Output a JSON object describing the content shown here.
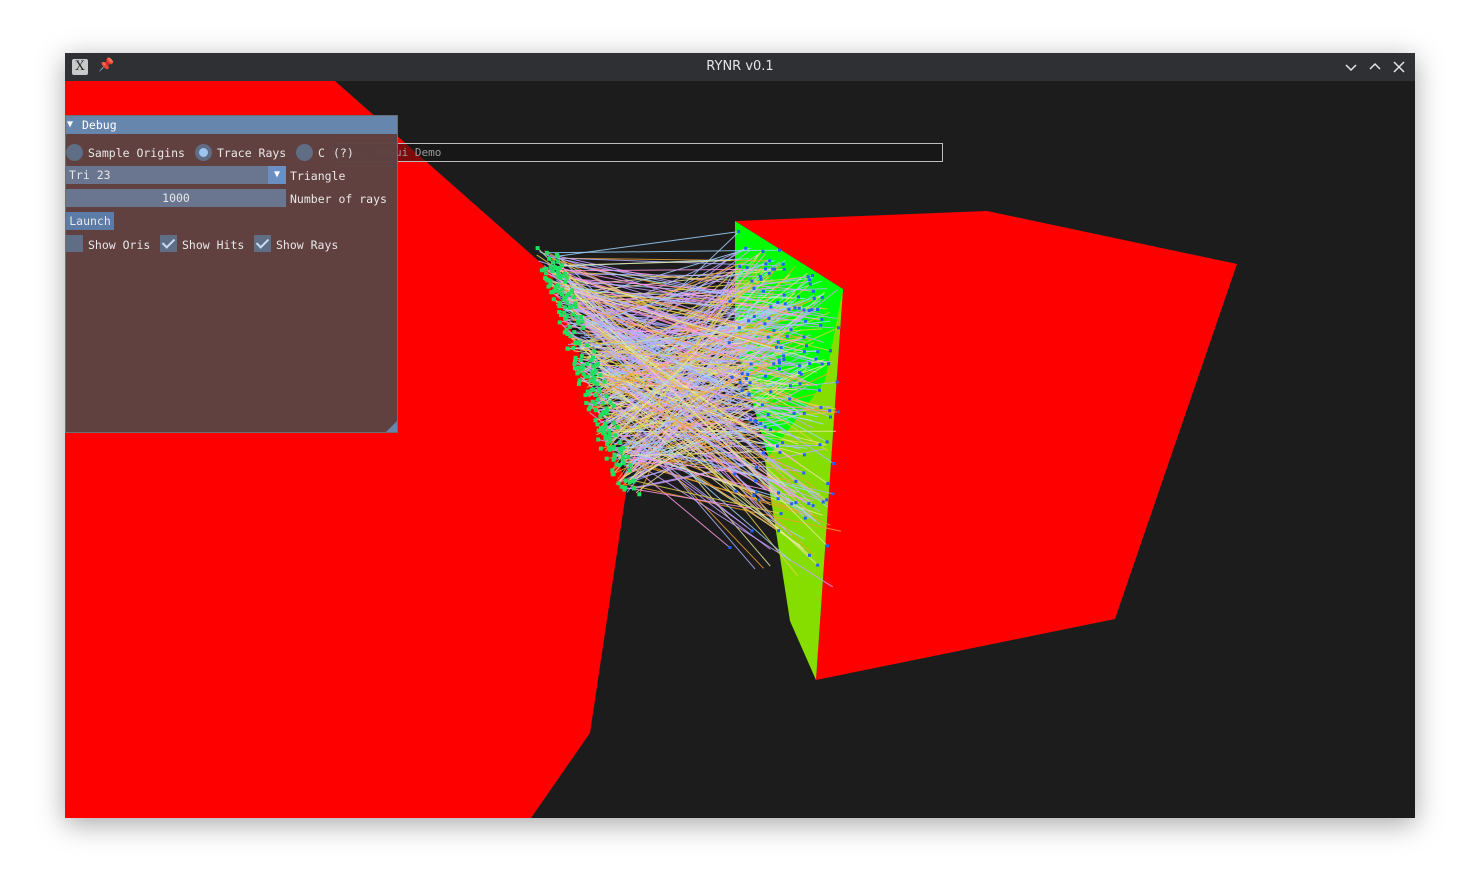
{
  "window": {
    "title": "RYNR v0.1",
    "app_icon": "x11-icon",
    "app_icon_glyph": "X",
    "pin_icon": "pin-icon",
    "controls": [
      "minimize-icon",
      "maximize-icon",
      "close-icon"
    ]
  },
  "scene": {
    "background": "#1c1c1c",
    "object_color": "#ff0000",
    "light_face_color": "#00ff00",
    "light_face_color_2": "#86dd00",
    "ray_colors": [
      "#c9a0ff",
      "#e0d24a",
      "#9fd3ff",
      "#e8e8a0",
      "#ff9ae8",
      "#f0a030",
      "#b0b0ff"
    ],
    "hit_marker_color": "#2060ff",
    "origin_marker_color": "#20e060"
  },
  "demo_window": {
    "title": "Dear ImGui Demo"
  },
  "debug": {
    "title": "Debug",
    "modes": [
      {
        "label": "Sample Origins",
        "selected": false
      },
      {
        "label": "Trace Rays",
        "selected": true
      },
      {
        "label": "C",
        "selected": false
      }
    ],
    "help_marker": "(?)",
    "triangle_combo": {
      "value": "Tri 23",
      "label": "Triangle"
    },
    "rays_slider": {
      "value": "1000",
      "label": "Number of rays"
    },
    "launch_label": "Launch",
    "toggles": [
      {
        "label": "Show Oris",
        "checked": false
      },
      {
        "label": "Show Hits",
        "checked": true
      },
      {
        "label": "Show Rays",
        "checked": true
      }
    ]
  }
}
